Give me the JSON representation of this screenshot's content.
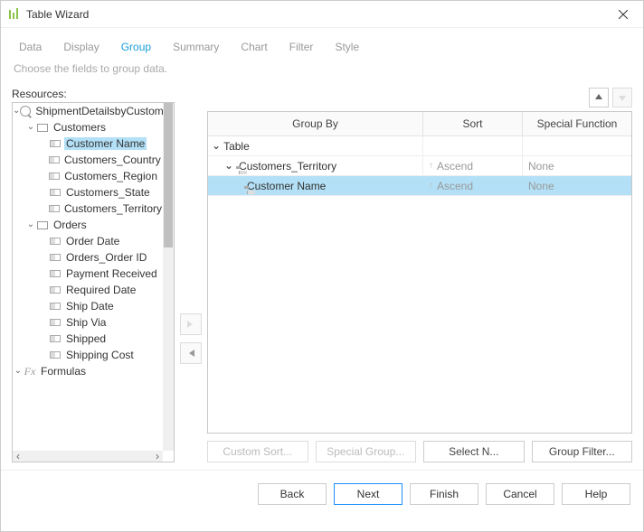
{
  "window": {
    "title": "Table Wizard"
  },
  "tabs": [
    "Data",
    "Display",
    "Group",
    "Summary",
    "Chart",
    "Filter",
    "Style"
  ],
  "active_tab": "Group",
  "subtitle": "Choose the fields to group data.",
  "resources": {
    "label": "Resources:",
    "tree": {
      "root": "ShipmentDetailsbyCustomer",
      "customers": {
        "label": "Customers",
        "fields": [
          "Customer Name",
          "Customers_Country",
          "Customers_Region",
          "Customers_State",
          "Customers_Territory"
        ]
      },
      "orders": {
        "label": "Orders",
        "fields": [
          "Order Date",
          "Orders_Order ID",
          "Payment Received",
          "Required Date",
          "Ship Date",
          "Ship Via",
          "Shipped",
          "Shipping Cost"
        ]
      },
      "formulas": "Formulas"
    },
    "selected": "Customer Name"
  },
  "gridcols": {
    "group": "Group By",
    "sort": "Sort",
    "func": "Special Function"
  },
  "gridrows": {
    "root": "Table",
    "r1": {
      "group": "Customers_Territory",
      "sort": "Ascend",
      "func": "None"
    },
    "r2": {
      "group": "Customer Name",
      "sort": "Ascend",
      "func": "None"
    }
  },
  "rowactions": {
    "custom": "Custom Sort...",
    "special": "Special Group...",
    "select": "Select N...",
    "filter": "Group Filter..."
  },
  "footer": {
    "back": "Back",
    "next": "Next",
    "finish": "Finish",
    "cancel": "Cancel",
    "help": "Help"
  }
}
